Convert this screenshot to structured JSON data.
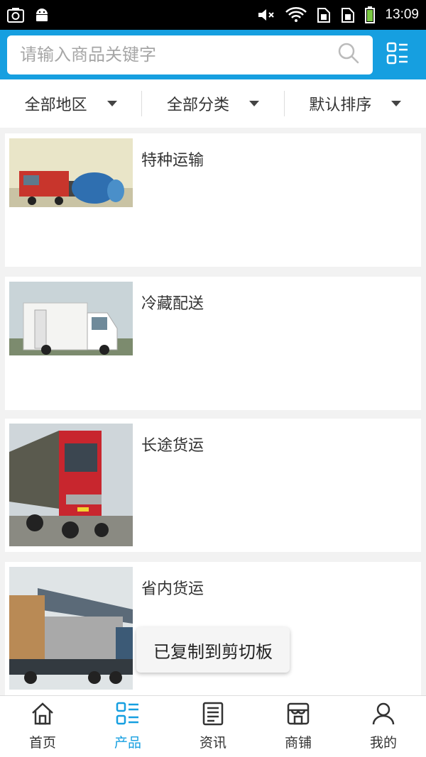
{
  "status_bar": {
    "time": "13:09",
    "left_icons": [
      "screenshot-icon",
      "android-icon"
    ],
    "right_icons": [
      "volume-muted-icon",
      "wifi-icon",
      "sim1-icon",
      "sim2-icon",
      "battery-icon"
    ]
  },
  "search": {
    "placeholder": "请输入商品关键字"
  },
  "filters": [
    {
      "label": "全部地区"
    },
    {
      "label": "全部分类"
    },
    {
      "label": "默认排序"
    }
  ],
  "products": [
    {
      "title": "特种运输"
    },
    {
      "title": "冷藏配送"
    },
    {
      "title": "长途货运"
    },
    {
      "title": "省内货运"
    }
  ],
  "toast": {
    "text": "已复制到剪切板"
  },
  "bottom_nav": [
    {
      "label": "首页",
      "icon": "home-icon"
    },
    {
      "label": "产品",
      "icon": "product-list-icon",
      "active": true
    },
    {
      "label": "资讯",
      "icon": "news-icon"
    },
    {
      "label": "商铺",
      "icon": "shop-icon"
    },
    {
      "label": "我的",
      "icon": "user-icon"
    }
  ],
  "colors": {
    "primary": "#169fe0",
    "status_bar": "#000000",
    "background": "#f2f2f2"
  }
}
